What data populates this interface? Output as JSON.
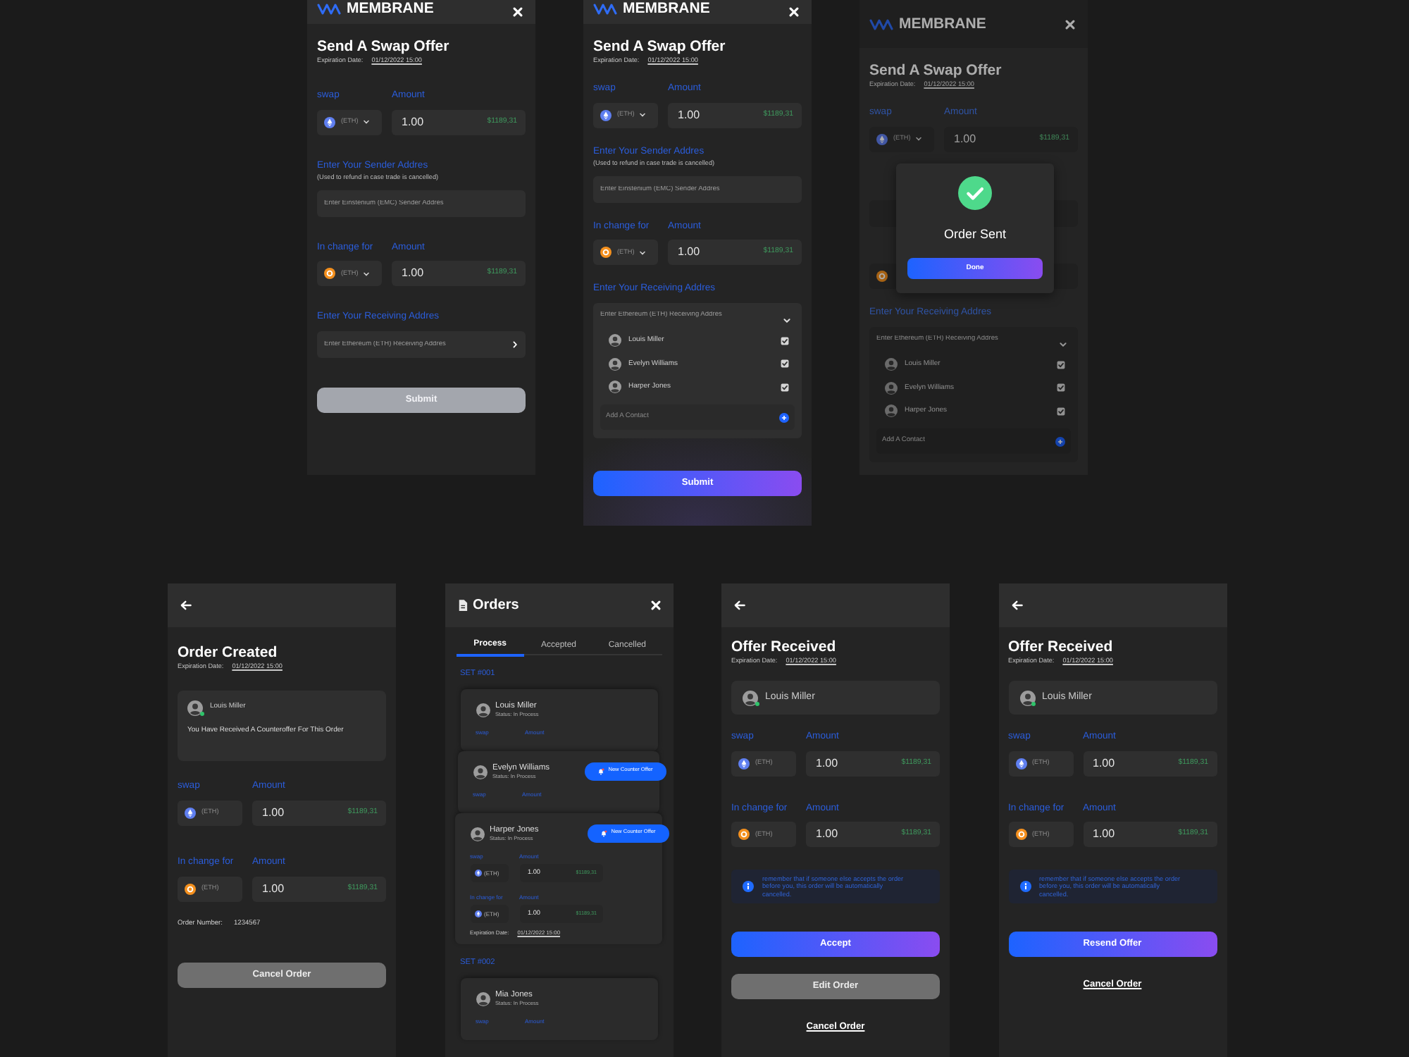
{
  "rows": [
    {
      "screens": [
        {
          "kind": "form",
          "header": {
            "kind": "logo",
            "logo": "MEMBRANE"
          },
          "blocks": [
            {
              "kind": "title",
              "text": "Send A Swap Offer"
            },
            {
              "kind": "expiry",
              "label": "Expiration Date:",
              "date": "01/12/2022 15:00"
            },
            {
              "kind": "pair",
              "label": "swap",
              "amount_label": "Amount",
              "coin": {
                "kind": "eth"
              },
              "ticker": "(ETH)",
              "dropdown": true,
              "amount": "1.00",
              "fiat": "$1189,31"
            },
            {
              "kind": "address",
              "label": "Enter Your Sender Addres",
              "note": "(Used to refund in case trade is cancelled)",
              "placeholder": "Enter Einstenium (EMC) Sender Addres"
            },
            {
              "kind": "pair",
              "label": "In change for",
              "amount_label": "Amount",
              "coin": {
                "kind": "btc"
              },
              "ticker": "(ETH)",
              "dropdown": true,
              "amount": "1.00",
              "fiat": "$1189,31"
            },
            {
              "kind": "picker",
              "label": "Enter Your Receiving Addres",
              "placeholder": "Enter Ethereum (ETH) Receiving Addres",
              "expanded": false
            },
            {
              "kind": "primary",
              "text": "Submit",
              "disabled": true
            }
          ]
        },
        {
          "kind": "form",
          "header": {
            "kind": "logo",
            "logo": "MEMBRANE"
          },
          "blocks": [
            {
              "kind": "title",
              "text": "Send A Swap Offer"
            },
            {
              "kind": "expiry",
              "label": "Expiration Date:",
              "date": "01/12/2022 15:00"
            },
            {
              "kind": "pair",
              "label": "swap",
              "amount_label": "Amount",
              "coin": {
                "kind": "eth"
              },
              "ticker": "(ETH)",
              "dropdown": true,
              "amount": "1.00",
              "fiat": "$1189,31"
            },
            {
              "kind": "address",
              "label": "Enter Your Sender Addres",
              "note": "(Used to refund in case trade is cancelled)",
              "placeholder": "Enter Einstenium (EMC) Sender Addres"
            },
            {
              "kind": "pair",
              "label": "In change for",
              "amount_label": "Amount",
              "coin": {
                "kind": "btc"
              },
              "ticker": "(ETH)",
              "dropdown": true,
              "amount": "1.00",
              "fiat": "$1189,31"
            },
            {
              "kind": "picker",
              "label": "Enter Your Receiving Addres",
              "placeholder": "Enter Ethereum (ETH) Receiving Addres",
              "expanded": true,
              "contacts": [
                {
                  "name": "Louis Miller",
                  "checked": true
                },
                {
                  "name": "Evelyn Williams",
                  "checked": true
                },
                {
                  "name": "Harper Jones",
                  "checked": true
                }
              ],
              "add_label": "Add A Contact"
            },
            {
              "kind": "primary",
              "text": "Submit",
              "disabled": false
            }
          ]
        },
        {
          "kind": "form",
          "header": {
            "kind": "logo",
            "logo": "MEMBRANE"
          },
          "blocks": [
            {
              "kind": "title",
              "text": "Send A Swap Offer"
            },
            {
              "kind": "expiry",
              "label": "Expiration Date:",
              "date": "01/12/2022 15:00"
            },
            {
              "kind": "pair",
              "label": "swap",
              "amount_label": "Amount",
              "coin": {
                "kind": "eth"
              },
              "ticker": "(ETH)",
              "dropdown": true,
              "amount": "1.00",
              "fiat": "$1189,31"
            },
            {
              "kind": "address"
            },
            {
              "kind": "pair",
              "coin": {
                "kind": "btc"
              }
            },
            {
              "kind": "picker",
              "label": "Enter Your Receiving Addres",
              "placeholder": "Enter Ethereum (ETH) Receiving Addres",
              "expanded": true,
              "contacts": [
                {
                  "name": "Louis Miller",
                  "checked": true
                },
                {
                  "name": "Evelyn Williams",
                  "checked": true
                },
                {
                  "name": "Harper Jones",
                  "checked": true
                }
              ],
              "add_label": "Add A Contact"
            }
          ],
          "modal": {
            "title": "Order Sent",
            "button": "Done"
          }
        }
      ]
    },
    {
      "screens": [
        {
          "kind": "form",
          "header": {
            "kind": "back"
          },
          "blocks": [
            {
              "kind": "title",
              "text": "Order Created"
            },
            {
              "kind": "expiry",
              "label": "Expiration Date:",
              "date": "01/12/2022 15:00"
            },
            {
              "kind": "notice",
              "name": "Louis Miller",
              "online": true,
              "message": "You Have Received A Counteroffer For This Order"
            },
            {
              "kind": "pair",
              "label": "swap",
              "amount_label": "Amount",
              "coin": {
                "kind": "eth"
              },
              "ticker": "(ETH)",
              "dropdown": false,
              "amount": "1.00",
              "fiat": "$1189,31"
            },
            {
              "kind": "pair",
              "label": "In change for",
              "amount_label": "Amount",
              "coin": {
                "kind": "btc"
              },
              "ticker": "(ETH)",
              "dropdown": false,
              "amount": "1.00",
              "fiat": "$1189,31"
            },
            {
              "kind": "order_number",
              "label": "Order Number:",
              "value": "1234567"
            },
            {
              "kind": "secondary",
              "text": "Cancel Order"
            }
          ]
        },
        {
          "kind": "orders",
          "header": {
            "kind": "titled",
            "title": "Orders"
          },
          "tabs": [
            {
              "label": "Process",
              "selected": true
            },
            {
              "label": "Accepted",
              "selected": false
            },
            {
              "label": "Cancelled",
              "selected": false
            }
          ],
          "sets": [
            {
              "label": "SET #001",
              "orders": [
                {
                  "name": "Louis Miller",
                  "status": "Status: In Process",
                  "pairs": [
                    {
                      "label": "swap",
                      "amount_label": "Amount"
                    }
                  ]
                },
                {
                  "name": "Evelyn Williams",
                  "status": "Status: In Process",
                  "badge": "New Counter Offer",
                  "pairs": [
                    {
                      "label": "swap",
                      "amount_label": "Amount"
                    }
                  ]
                },
                {
                  "name": "Harper Jones",
                  "status": "Status: In Process",
                  "badge": "New Counter Offer",
                  "pairs": [
                    {
                      "label": "swap",
                      "amount_label": "Amount",
                      "coin": {
                        "kind": "eth"
                      },
                      "ticker": "(ETH)",
                      "amount": "1.00",
                      "fiat": "$1189,31"
                    },
                    {
                      "label": "In change for",
                      "amount_label": "Amount",
                      "coin": {
                        "kind": "eth"
                      },
                      "ticker": "(ETH)",
                      "amount": "1.00",
                      "fiat": "$1189,31"
                    }
                  ],
                  "expiry": {
                    "label": "Expiration Date:",
                    "date": "01/12/2022 15:00"
                  }
                }
              ]
            },
            {
              "label": "SET #002",
              "orders": [
                {
                  "name": "Mia Jones",
                  "status": "Status: In Process",
                  "pairs": [
                    {
                      "label": "swap",
                      "amount_label": "Amount"
                    }
                  ]
                }
              ]
            }
          ]
        },
        {
          "kind": "form",
          "header": {
            "kind": "back"
          },
          "blocks": [
            {
              "kind": "title",
              "text": "Offer Received"
            },
            {
              "kind": "expiry",
              "label": "Expiration Date:",
              "date": "01/12/2022 15:00"
            },
            {
              "kind": "user",
              "name": "Louis Miller",
              "online": true
            },
            {
              "kind": "pair",
              "label": "swap",
              "amount_label": "Amount",
              "coin": {
                "kind": "eth"
              },
              "ticker": "(ETH)",
              "dropdown": false,
              "amount": "1.00",
              "fiat": "$1189,31"
            },
            {
              "kind": "pair",
              "label": "In change for",
              "amount_label": "Amount",
              "coin": {
                "kind": "btc"
              },
              "ticker": "(ETH)",
              "dropdown": false,
              "amount": "1.00",
              "fiat": "$1189,31"
            },
            {
              "kind": "info",
              "text": "remember that if someone else accepts the order before you, this order will be automatically cancelled."
            },
            {
              "kind": "primary",
              "text": "Accept"
            },
            {
              "kind": "secondary",
              "text": "Edit Order"
            },
            {
              "kind": "link",
              "text": "Cancel Order"
            }
          ]
        },
        {
          "kind": "form",
          "header": {
            "kind": "back"
          },
          "blocks": [
            {
              "kind": "title",
              "text": "Offer Received"
            },
            {
              "kind": "expiry",
              "label": "Expiration Date:",
              "date": "01/12/2022 15:00"
            },
            {
              "kind": "user",
              "name": "Louis Miller",
              "online": true
            },
            {
              "kind": "pair",
              "label": "swap",
              "amount_label": "Amount",
              "coin": {
                "kind": "eth"
              },
              "ticker": "(ETH)",
              "dropdown": false,
              "amount": "1.00",
              "fiat": "$1189,31"
            },
            {
              "kind": "pair",
              "label": "In change for",
              "amount_label": "Amount",
              "coin": {
                "kind": "btc"
              },
              "ticker": "(ETH)",
              "dropdown": false,
              "amount": "1.00",
              "fiat": "$1189,31"
            },
            {
              "kind": "info",
              "text": "remember that if someone else accepts the order before you, this order will be automatically cancelled."
            },
            {
              "kind": "primary",
              "text": "Resend Offer"
            },
            {
              "kind": "link",
              "text": "Cancel Order"
            }
          ]
        }
      ]
    }
  ]
}
